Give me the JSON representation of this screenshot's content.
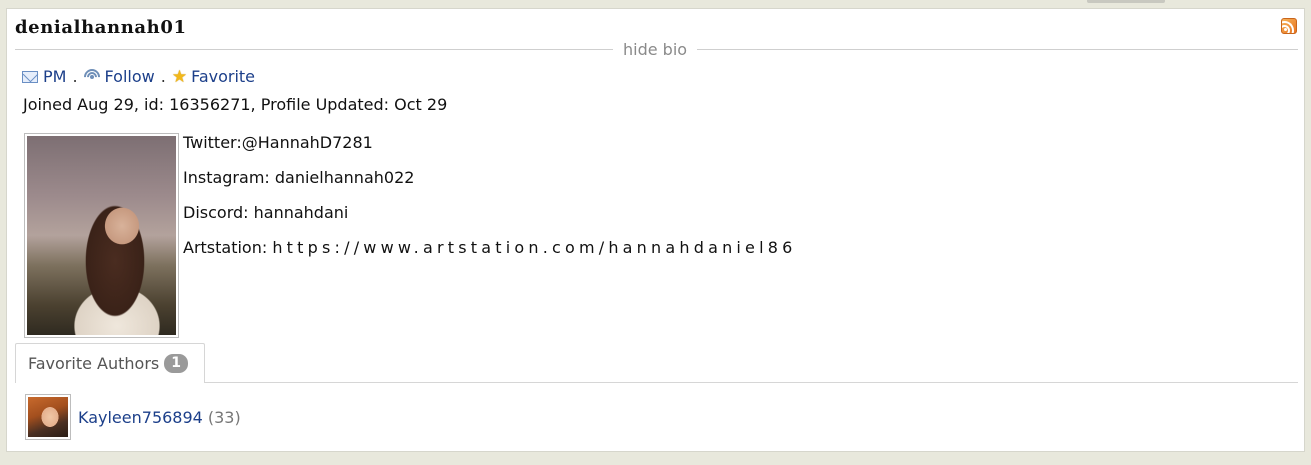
{
  "profile": {
    "username": "denialhannah01",
    "hide_bio_label": "hide bio",
    "actions": {
      "pm_label": "PM",
      "follow_label": "Follow",
      "favorite_label": "Favorite",
      "separator": "."
    },
    "joined_text": "Joined Aug 29, id: 16356271, Profile Updated: Oct 29",
    "bio": {
      "twitter": "Twitter:@HannahD7281",
      "instagram": "Instagram: danielhannah022",
      "discord": "Discord: hannahdani",
      "artstation_label": "Artstation:",
      "artstation_url": "https://www.artstation.com/hannahdaniel86"
    }
  },
  "tabs": [
    {
      "label": "Favorite Authors",
      "count": "1"
    }
  ],
  "favorite_authors": [
    {
      "name": "Kayleen756894",
      "count": "(33)"
    }
  ],
  "icons": {
    "rss": "rss-icon",
    "pm": "mail-icon",
    "follow": "follow-icon",
    "favorite": "star-icon"
  }
}
